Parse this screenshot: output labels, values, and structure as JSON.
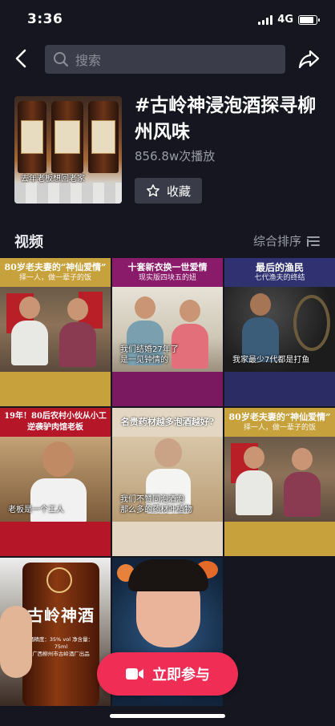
{
  "status_bar": {
    "time": "3:36",
    "network": "4G",
    "battery_level": 0.85
  },
  "search": {
    "placeholder": "搜索"
  },
  "topic": {
    "title": "#古岭神浸泡酒探寻柳州风味",
    "plays": "856.8w次播放",
    "cover_caption": "去年老板想回老家",
    "favorite_label": "收藏"
  },
  "videos_section": {
    "title": "视频",
    "sort_label": "综合排序"
  },
  "videos": [
    {
      "headline": "80岁老夫妻的“神仙爱情”",
      "subline": "择一人，做一辈子的饭",
      "caption": ""
    },
    {
      "headline": "十套新衣换一世爱情",
      "subline": "现实版四块五的妞",
      "caption_line1": "我们结婚27年了",
      "caption_line2": "是一见钟情的"
    },
    {
      "headline": "最后的渔民",
      "subline": "七代渔夫的终结",
      "caption": "我家最少7代都是打鱼"
    },
    {
      "headline_line1": "19年！80后农村小伙从小工",
      "headline_line2": "逆袭驴肉馆老板",
      "caption": "老板是一个工人"
    },
    {
      "headline": "名贵药材越多泡酒越好?",
      "caption_line1": "我们不赞同泡酒泡",
      "caption_line2": "那么多的药材叶植物"
    },
    {
      "headline": "80岁老夫妻的“神仙爱情”",
      "subline": "择一人，做一辈子的饭",
      "caption": ""
    },
    {
      "bottle_brand": "古岭神酒",
      "bottle_spec": "酒精度：35% vol  净含量：75ml",
      "bottle_maker": "广西柳州市古岭酒厂出品"
    },
    {
      "caption": ""
    }
  ],
  "join_button": {
    "label": "立即参与"
  },
  "colors": {
    "background": "#15161f",
    "search_bg": "#3a3c49",
    "accent_red": "#f02e55",
    "banner_gold": "#c7a23c",
    "banner_purple": "#8a1a6a",
    "banner_navy": "#2f3170",
    "banner_red": "#b51628"
  }
}
